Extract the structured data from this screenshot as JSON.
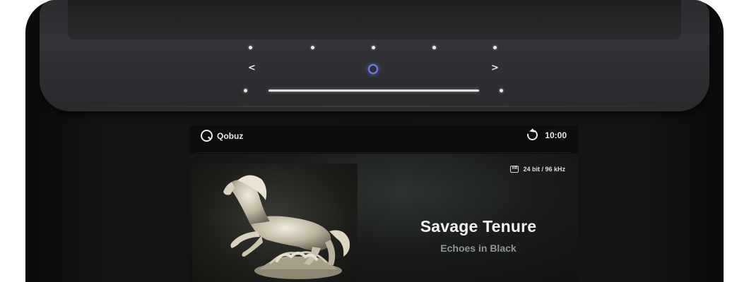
{
  "device": {
    "accent_color": "#6f7cf2",
    "controls": {
      "left_arrow_icon": "chevron-left-icon",
      "right_arrow_icon": "chevron-right-icon",
      "center_icon": "ring-icon",
      "left_arrow_glyph": "<",
      "right_arrow_glyph": ">"
    }
  },
  "screen": {
    "source": {
      "label": "Qobuz",
      "icon": "qobuz-logo-icon"
    },
    "status": {
      "time": "10:00",
      "icon": "sync-icon"
    },
    "now_playing": {
      "format": "24 bit / 96 kHz",
      "format_icon": "hi-res-icon",
      "title": "Savage Tenure",
      "artist": "Echoes in Black"
    }
  }
}
